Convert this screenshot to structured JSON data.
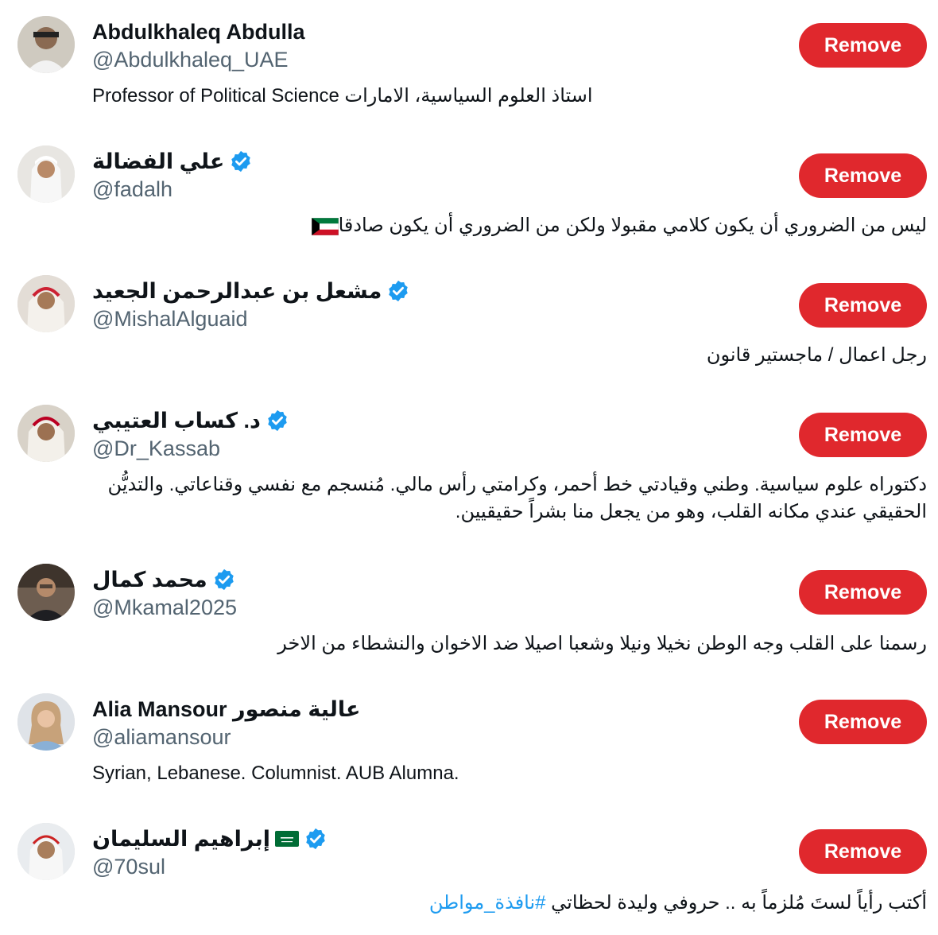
{
  "accounts": [
    {
      "name": "Abdulkhaleq Abdulla",
      "handle": "@Abdulkhaleq_UAE",
      "verified": false,
      "bio": "Professor of Political Science استاذ العلوم السياسية، الامارات",
      "bio_dir": "ltr",
      "button": "Remove"
    },
    {
      "name": "علي الفضالة",
      "handle": "@fadalh",
      "verified": true,
      "bio": "ليس من الضروري أن يكون كلامي مقبولا ولكن من الضروري أن يكون صادقا",
      "bio_flag": "kuwait-flag-icon",
      "bio_dir": "rtl",
      "button": "Remove"
    },
    {
      "name": "مشعل بن عبدالرحمن الجعيد",
      "handle": "@MishalAlguaid",
      "verified": true,
      "bio": "رجل اعمال / ماجستير قانون",
      "bio_dir": "rtl",
      "button": "Remove"
    },
    {
      "name": "د. كساب العتيبي",
      "handle": "@Dr_Kassab",
      "verified": true,
      "bio": "دكتوراه علوم سياسية. وطني وقيادتي خط أحمر، وكرامتي رأس مالي. مُنسجم مع نفسي وقناعاتي. والتديُّن الحقيقي عندي مكانه القلب، وهو من يجعل منا بشراً حقيقيين.",
      "bio_dir": "rtl",
      "button": "Remove"
    },
    {
      "name": "محمد كمال",
      "handle": "@Mkamal2025",
      "verified": true,
      "bio": "رسمنا على القلب وجه الوطن نخيلا ونيلا وشعبا اصيلا ضد الاخوان والنشطاء من الاخر",
      "bio_dir": "rtl",
      "button": "Remove"
    },
    {
      "name": "Alia Mansour عالية منصور",
      "handle": "@aliamansour",
      "verified": false,
      "bio": "Syrian, Lebanese. Columnist. AUB Alumna.",
      "bio_dir": "ltr",
      "button": "Remove"
    },
    {
      "name": "إبراهيم السليمان",
      "name_flag": "saudi-flag-icon",
      "handle": "@70sul",
      "verified": true,
      "bio": "أكتب رأياً لستَ مُلزماً به .. حروفي وليدة لحظاتي",
      "bio_hashtag": "#نافذة_مواطن",
      "bio_dir": "rtl",
      "button": "Remove"
    }
  ],
  "colors": {
    "remove_button": "#e0282d",
    "verified_badge": "#1d9bf0",
    "handle_text": "#536471",
    "hashtag": "#1d9bf0"
  }
}
